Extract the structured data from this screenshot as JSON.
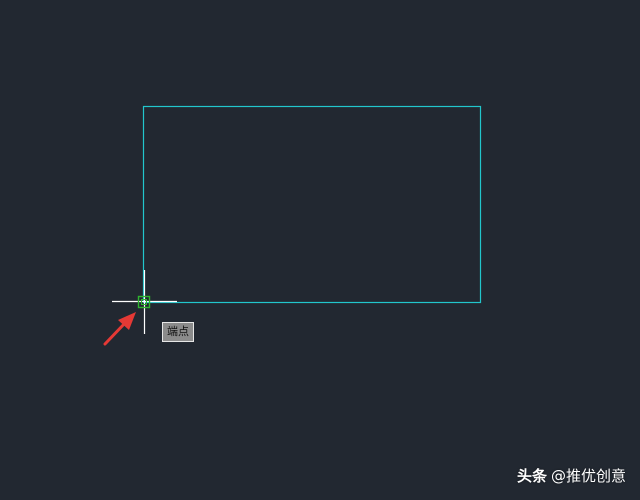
{
  "canvas": {
    "background_color": "#222831",
    "geometry_color": "#22c6cc",
    "crosshair_color": "#ffffff",
    "snap_marker_color": "#2fb52f",
    "arrow_color": "#e53935"
  },
  "snap_tooltip": {
    "label": "端点"
  },
  "watermark": {
    "brand": "头条",
    "handle": "@推优创意"
  }
}
